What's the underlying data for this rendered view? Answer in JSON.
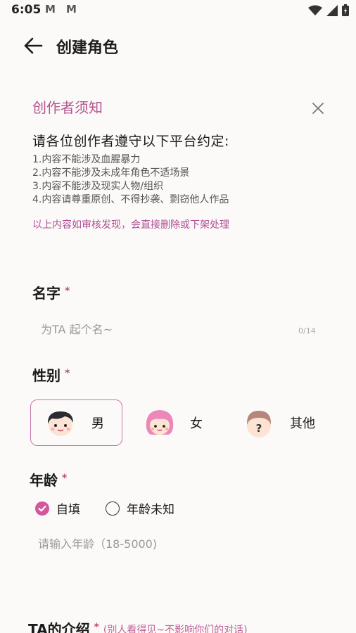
{
  "status_bar": {
    "time": "6:05",
    "mail_icons": [
      "M",
      "M"
    ]
  },
  "header": {
    "title": "创建角色"
  },
  "notice": {
    "title": "创作者须知",
    "heading": "请各位创作者遵守以下平台约定:",
    "rules": [
      "1.内容不能涉及血腥暴力",
      "2.内容不能涉及未成年角色不适场景",
      "3.内容不能涉及现实人物/组织",
      "4.内容请尊重原创、不得抄袭、剽窃他人作品"
    ],
    "warning": "以上内容如审核发现，会直接删除或下架处理"
  },
  "name": {
    "label": "名字",
    "required_mark": "*",
    "placeholder": "为TA 起个名~",
    "counter": "0/14"
  },
  "gender": {
    "label": "性别",
    "required_mark": "*",
    "options": [
      {
        "label": "男",
        "icon": "male-avatar-icon",
        "selected": true
      },
      {
        "label": "女",
        "icon": "female-avatar-icon",
        "selected": false
      },
      {
        "label": "其他",
        "icon": "unknown-avatar-icon",
        "selected": false
      }
    ]
  },
  "age": {
    "label": "年龄",
    "required_mark": "*",
    "options": [
      {
        "label": "自填",
        "selected": true
      },
      {
        "label": "年龄未知",
        "selected": false
      }
    ],
    "placeholder": "请输入年龄（18-5000)"
  },
  "intro": {
    "label": "TA的介绍",
    "required_mark": "*",
    "hint": "(别人看得见~不影响你们的对话)"
  },
  "colors": {
    "accent": "#b5548f",
    "radio_selected": "#d4579d",
    "required": "#c2506e",
    "background": "#fbfaf8"
  }
}
